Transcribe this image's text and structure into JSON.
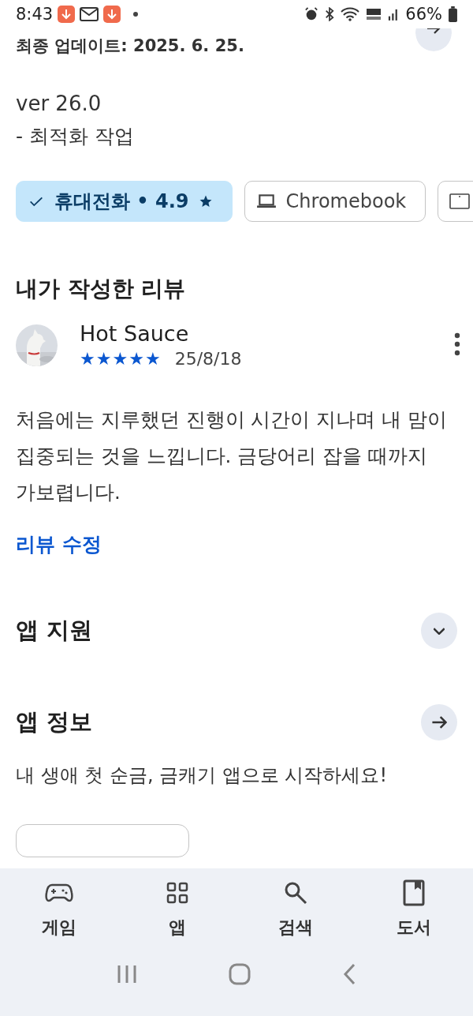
{
  "status_bar": {
    "time": "8:43",
    "battery": "66%"
  },
  "update": {
    "last_updated": "최종 업데이트: 2025. 6. 25.",
    "version": "ver 26.0",
    "notes": "- 최적화 작업"
  },
  "device_chips": [
    {
      "kind": "phone",
      "label": "휴대전화 • 4.9",
      "selected": true
    },
    {
      "kind": "laptop",
      "label": "Chromebook",
      "selected": false
    },
    {
      "kind": "tablet",
      "selected": false
    }
  ],
  "my_review": {
    "heading": "내가 작성한 리뷰",
    "author": "Hot Sauce",
    "stars": 5,
    "date": "25/8/18",
    "text": "처음에는 지루했던 진행이 시간이  지나며 내 맘이 집중되는 것을 느낍니다. 금당어리 잡을 때까지 가보렵니다.",
    "edit_link": "리뷰 수정"
  },
  "sections": [
    {
      "kind": "expand",
      "title": "앱 지원"
    },
    {
      "kind": "arrow",
      "title": "앱 정보",
      "description": "내 생애 첫 순금, 금캐기 앱으로 시작하세요!"
    }
  ],
  "bottom_nav": [
    {
      "kind": "games",
      "label": "게임"
    },
    {
      "kind": "apps",
      "label": "앱"
    },
    {
      "kind": "search",
      "label": "검색"
    },
    {
      "kind": "books",
      "label": "도서"
    }
  ]
}
